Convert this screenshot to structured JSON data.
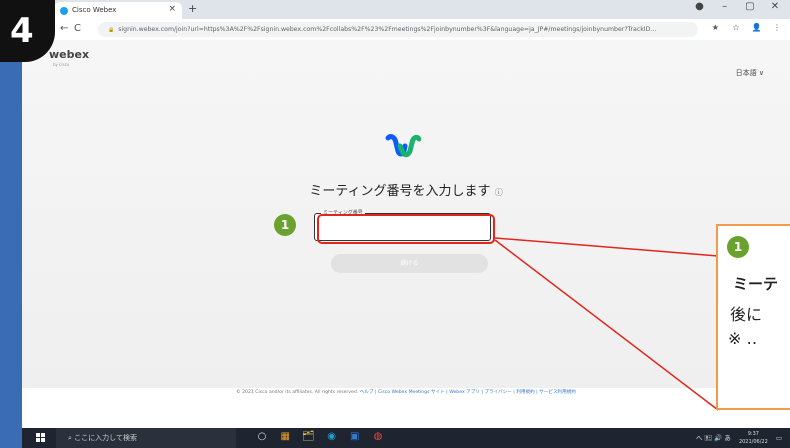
{
  "browser": {
    "tab_title": "Cisco Webex",
    "tab_close": "×",
    "new_tab": "+",
    "url": "signin.webex.com/join?url=https%3A%2F%2Fsignin.webex.com%2Fcollabs%2F%23%2Fmeetings%2Fjoinbynumber%3F&language=ja_JP#/meetings/joinbynumber?TrackID...",
    "window_controls": [
      "●",
      "–",
      "▢",
      "✕"
    ],
    "nav": {
      "back": "←",
      "reload": "C",
      "lock": "🔒"
    },
    "toolbar_icons": [
      "★",
      "☆",
      "👤",
      "⋮"
    ]
  },
  "page": {
    "logo": "webex",
    "logo_sub": "by cisco",
    "language": "日本語 ∨",
    "heading": "ミーティング番号を入力します",
    "heading_info": "ⓘ",
    "field_label": "ミーティング番号",
    "field_value": "",
    "next_button": "続ける",
    "footer_text": "© 2021 Cisco and/or its affiliates. All rights reserved.",
    "footer_links": "ヘルプ | Cisco Webex Meetings サイト | Webex アプリ | プライバシー | 利用規約 | サービス利用規約",
    "brand_colors": {
      "wx_blue": "#0b5cff",
      "wx_green": "#19b36b"
    }
  },
  "annotation": {
    "step_number": "4",
    "badge_field": "1",
    "badge_callout": "1",
    "callout_line1": "ミーテ",
    "callout_line2": "後に",
    "callout_line3": "※ ‥",
    "highlight_color": "#e0271b",
    "callout_border_color": "#f29a49",
    "badge_color": "#6aa12f"
  },
  "taskbar": {
    "search_placeholder": "ここに入力して検索",
    "apps": [
      "○",
      "▦",
      "🗂",
      "◉",
      "▣",
      "◍"
    ],
    "tray": "へ 🖭 🔊 あ",
    "time": "9:37",
    "date": "2021/06/22"
  }
}
